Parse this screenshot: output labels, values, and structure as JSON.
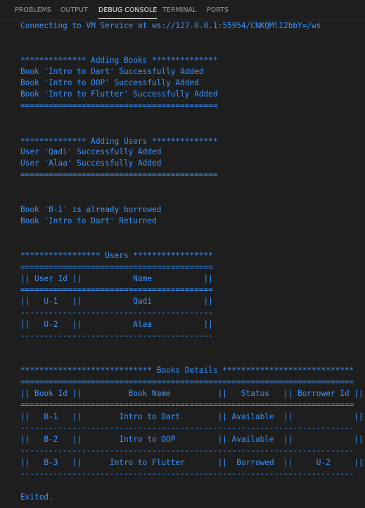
{
  "tabs": [
    {
      "label": "PROBLEMS"
    },
    {
      "label": "OUTPUT"
    },
    {
      "label": "DEBUG CONSOLE"
    },
    {
      "label": "TERMINAL"
    },
    {
      "label": "PORTS"
    }
  ],
  "active_tab": "DEBUG CONSOLE",
  "console": {
    "connecting": "Connecting to VM Service at ws://127.0.0.1:55954/CNKQMlI2bbY=/ws",
    "books_header": "************** Adding Books **************",
    "book_added_1": "Book 'Intro to Dart' Successfully Added",
    "book_added_2": "Book 'Intro to OOP' Successfully Added",
    "book_added_3": "Book 'Intro to Flutter' Successfully Added",
    "books_divider": "==========================================",
    "users_header": "************** Adding Users **************",
    "user_added_1": "User 'Qadi' Successfully Added",
    "user_added_2": "User 'Alaa' Successfully Added",
    "users_divider": "==========================================",
    "borrowed_msg": "Book 'B-1' is already borrowed",
    "returned_msg": "Book 'Intro to Dart' Returned",
    "users_table": {
      "title": "***************** Users *****************",
      "rule_top": "=========================================",
      "header": "|| User Id ||           Name           ||",
      "rule_header": "=========================================",
      "rows": [
        "||   U-1   ||           Qadi           ||",
        "||   U-2   ||           Alaa           ||"
      ],
      "row_separators": [
        "-----------------------------------------",
        "-----------------------------------------"
      ]
    },
    "books_table": {
      "title": "**************************** Books Details ****************************",
      "rule_top": "=======================================================================",
      "header": "|| Book Id ||          Book Name          ||   Status   || Borrower Id ||",
      "rule_header": "=======================================================================",
      "rows": [
        "||   B-1   ||        Intro to Dart        || Available  ||             ||",
        "||   B-2   ||        Intro to OOP         || Available  ||             ||",
        "||   B-3   ||      Intro to Flutter       ||  Borrowed  ||     U-2     ||"
      ],
      "row_separators": [
        "-----------------------------------------------------------------------",
        "-----------------------------------------------------------------------",
        "-----------------------------------------------------------------------"
      ]
    },
    "exited": "Exited."
  },
  "colors": {
    "background": "#1e1e1e",
    "console_text": "#3794ff",
    "tab_inactive": "#9d9d9d",
    "tab_active": "#e7e7e7"
  }
}
